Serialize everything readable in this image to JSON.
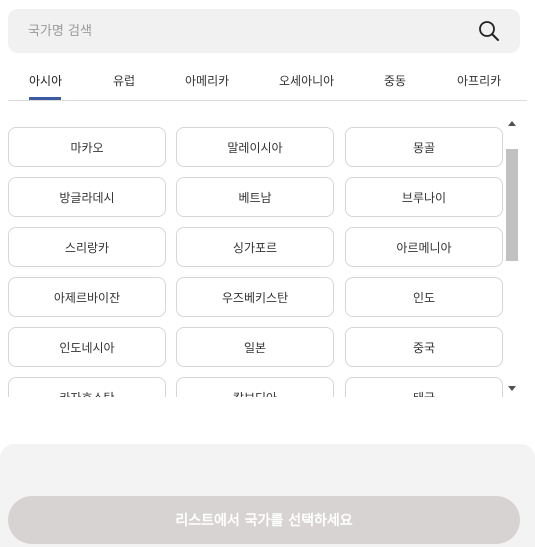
{
  "search": {
    "placeholder": "국가명 검색",
    "value": ""
  },
  "tabs": [
    {
      "label": "아시아",
      "active": true
    },
    {
      "label": "유럽"
    },
    {
      "label": "아메리카"
    },
    {
      "label": "오세아니아"
    },
    {
      "label": "중동"
    },
    {
      "label": "아프리카"
    }
  ],
  "countries": [
    "마카오",
    "말레이시아",
    "몽골",
    "방글라데시",
    "베트남",
    "브루나이",
    "스리랑카",
    "싱가포르",
    "아르메니아",
    "아제르바이잔",
    "우즈베키스탄",
    "인도",
    "인도네시아",
    "일본",
    "중국",
    "카자흐스탄",
    "캄보디아",
    "태국"
  ],
  "footer": {
    "button_label": "리스트에서 국가를 선택하세요"
  },
  "colors": {
    "accent": "#3b5ba5",
    "button_disabled": "#d7d3d2",
    "search_bg": "#f1f1f1"
  }
}
